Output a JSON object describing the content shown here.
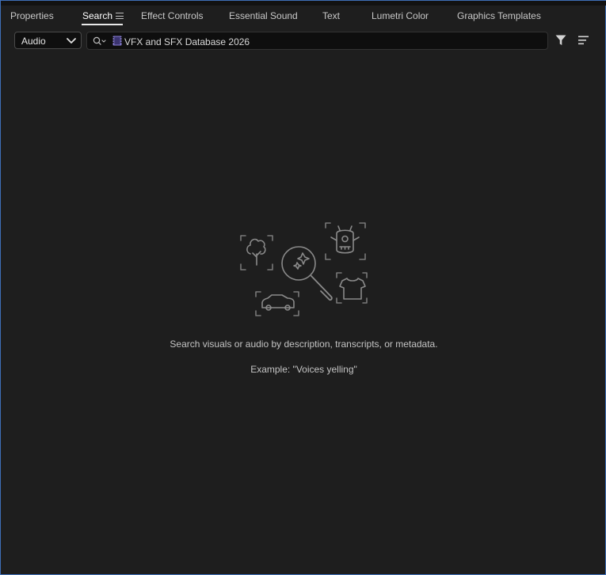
{
  "tabs": [
    {
      "label": "Properties"
    },
    {
      "label": "Search"
    },
    {
      "label": "Effect Controls"
    },
    {
      "label": "Essential Sound"
    },
    {
      "label": "Text"
    },
    {
      "label": "Lumetri Color"
    },
    {
      "label": "Graphics Templates"
    }
  ],
  "active_tab": "Search",
  "search": {
    "media_type": "Audio",
    "source": "VFX and SFX Database 2026"
  },
  "empty_state": {
    "line1": "Search visuals or audio by description, transcripts, or metadata.",
    "line2": "Example: \"Voices yelling\""
  },
  "colors": {
    "panel_bg": "#1e1e1e",
    "panel_border": "#3f6fb8",
    "database_icon": "#8a7fd6"
  },
  "icons": {
    "tab_menu": "hamburger-icon",
    "dropdown": "chevron-down-icon",
    "search": "search-icon",
    "source": "database-icon",
    "filter": "filter-icon",
    "sort": "sort-lines-icon"
  }
}
